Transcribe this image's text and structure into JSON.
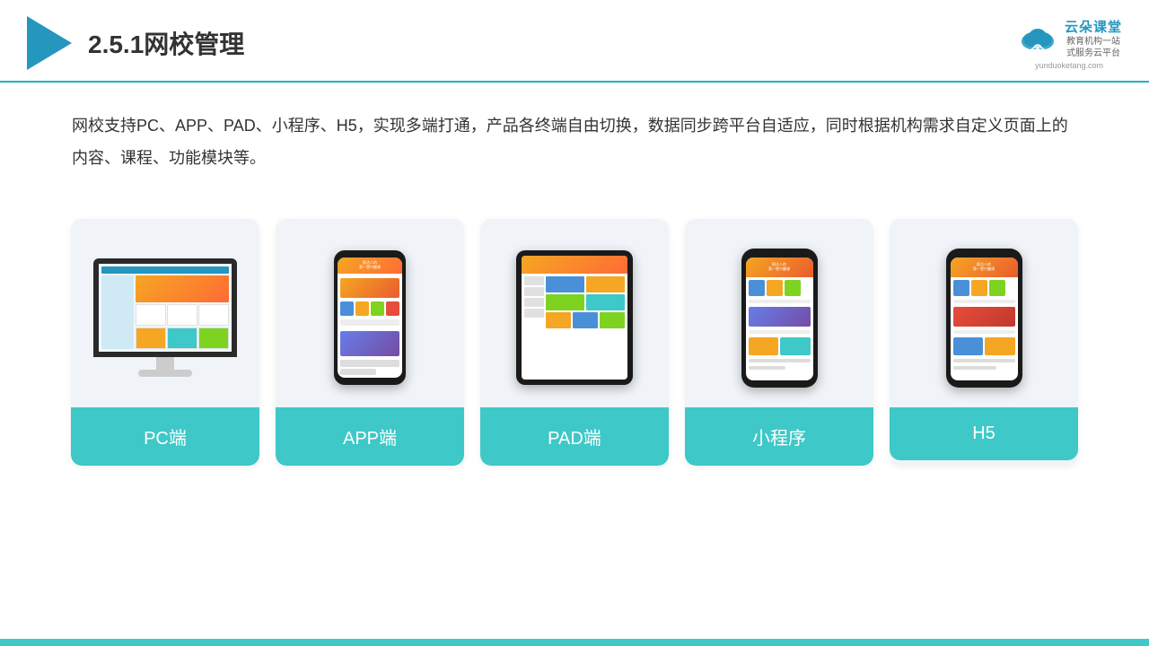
{
  "header": {
    "title": "2.5.1网校管理",
    "logo_name": "云朵课堂",
    "logo_url": "yunduoketang.com",
    "logo_tagline": "教育机构一站\n式服务云平台"
  },
  "description": "网校支持PC、APP、PAD、小程序、H5，实现多端打通，产品各终端自由切换，数据同步跨平台自适应，同时根据机构需求自定义页面上的内容、课程、功能模块等。",
  "cards": [
    {
      "id": "pc",
      "label": "PC端"
    },
    {
      "id": "app",
      "label": "APP端"
    },
    {
      "id": "pad",
      "label": "PAD端"
    },
    {
      "id": "miniprogram",
      "label": "小程序"
    },
    {
      "id": "h5",
      "label": "H5"
    }
  ],
  "colors": {
    "accent": "#3ec8c8",
    "header_line": "#1ab3c8",
    "title_color": "#333"
  }
}
